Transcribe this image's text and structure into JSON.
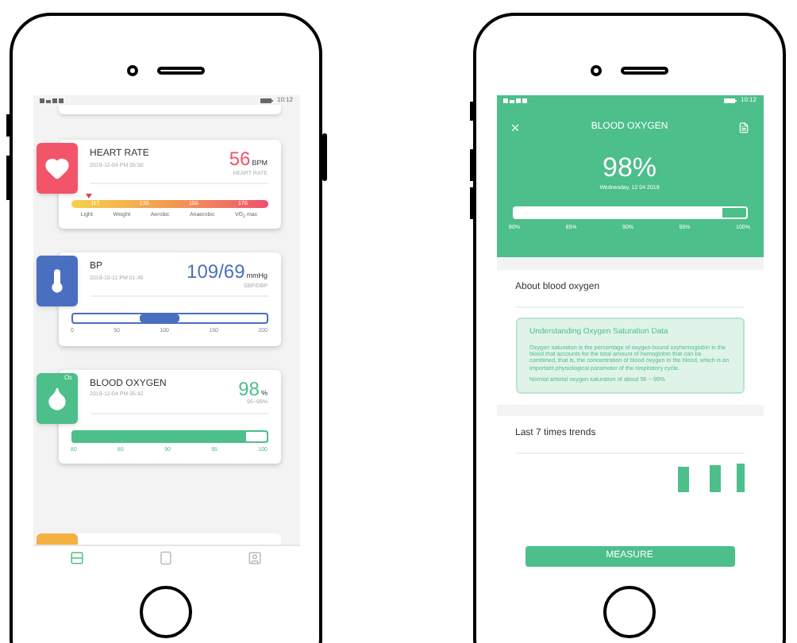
{
  "left_phone": {
    "status_bar": {
      "time": "10:12"
    },
    "cards": [
      {
        "kind": "heart_rate",
        "color": "#f2546a",
        "title": "HEART RATE",
        "timestamp": "2019-12-04 PM 05:50",
        "value": "56",
        "unit": "BPM",
        "caption": "HEART RATE",
        "level": 0.08,
        "zone_marks": [
          "117",
          "136",
          "156",
          "176"
        ],
        "zones": [
          "Light",
          "Weight",
          "Aerobic",
          "Anaerobic",
          "VO$_{2}$ max"
        ]
      },
      {
        "kind": "bp",
        "color": "#4a6fc1",
        "title": "BP",
        "timestamp": "2019-10-11 PM 01:49",
        "value": "109/69",
        "unit": "mmHg",
        "caption": "SBP/DBP",
        "level": 0.45,
        "ticks": [
          "0",
          "50",
          "100",
          "150",
          "200"
        ]
      },
      {
        "kind": "oxygen",
        "color": "#4cbf8a",
        "title": "BLOOD OXYGEN",
        "badge": "O$_{2}$",
        "timestamp": "2019-12-04 PM 05:42",
        "value": "98",
        "unit": "%",
        "caption": "96~99%",
        "level": 0.9,
        "ticks": [
          "80",
          "85",
          "90",
          "95",
          "100"
        ]
      }
    ],
    "bottom_nav": [
      {
        "kind": "list",
        "selected": true
      },
      {
        "kind": "device",
        "selected": false
      },
      {
        "kind": "user",
        "selected": false
      }
    ]
  },
  "right_phone": {
    "status_bar": {
      "time": "10:12"
    },
    "header": {
      "title": "BLOOD OXYGEN",
      "value": "98%",
      "date": "Wednesday, 12 04 2019",
      "level": 0.9,
      "ticks": [
        "80%",
        "85%",
        "90%",
        "95%",
        "100%"
      ]
    },
    "about": {
      "title": "About blood oxygen",
      "info_title": "Understanding Oxygen Saturation Data",
      "paragraphs": [
        "Oxygen saturation is the percentage of oxygen-bound oxyhemoglobin in the blood that accounts for the total amount of hemoglobin that can be combined, that is, the concentration of blood oxygen in the blood, which is an important physiological parameter of the respiratory cycle.",
        "Normal arterial oxygen saturation of about 96 ~ 99%"
      ]
    },
    "trends": {
      "title": "Last 7 times trends"
    },
    "button": "MEASURE"
  }
}
